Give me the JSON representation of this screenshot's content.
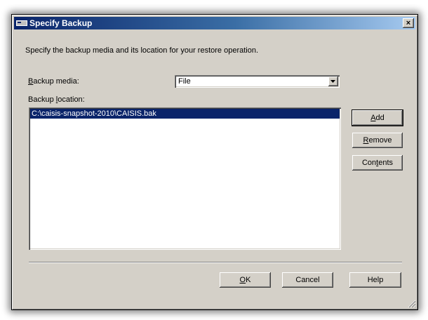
{
  "window": {
    "title": "Specify Backup",
    "close_glyph": "×"
  },
  "description": "Specify the backup media and its location for your restore operation.",
  "media": {
    "label_prefix": "",
    "label_key": "B",
    "label_rest": "ackup media:",
    "selected": "File"
  },
  "location": {
    "label_prefix": "Backup ",
    "label_key": "l",
    "label_rest": "ocation:",
    "items": [
      "C:\\caisis-snapshot-2010\\CAISIS.bak"
    ]
  },
  "side_buttons": {
    "add": {
      "key": "A",
      "rest": "dd"
    },
    "remove": {
      "key": "R",
      "rest": "emove"
    },
    "contents": {
      "prefix": "Con",
      "key": "t",
      "rest": "ents"
    }
  },
  "footer_buttons": {
    "ok": {
      "key": "O",
      "rest": "K"
    },
    "cancel": "Cancel",
    "help": "Help"
  },
  "colors": {
    "title_start": "#0a246a",
    "title_end": "#a6caf0",
    "selection": "#0a246a",
    "face": "#d4d0c8"
  }
}
